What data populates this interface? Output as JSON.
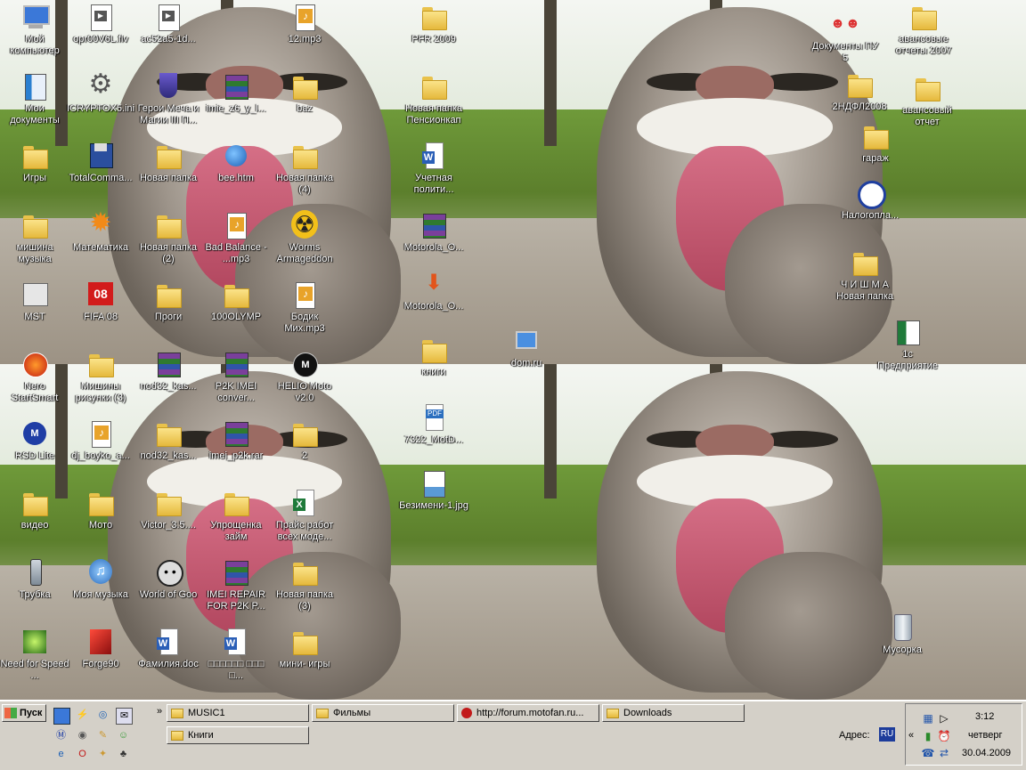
{
  "desktop": {
    "icons": [
      {
        "label": "Мой компьютер",
        "type": "computer"
      },
      {
        "label": "Мои документы",
        "type": "docs"
      },
      {
        "label": "Игры",
        "type": "folder"
      },
      {
        "label": "мишина музыка",
        "type": "folder"
      },
      {
        "label": "MST",
        "type": "mst"
      },
      {
        "label": "Nero StartSmart",
        "type": "round-red"
      },
      {
        "label": "RSD Lite",
        "type": "round-blue"
      },
      {
        "label": "видео",
        "type": "folder"
      },
      {
        "label": "Трубка",
        "type": "phone"
      },
      {
        "label": "Need for Speed ...",
        "type": "nfs"
      },
      {
        "label": "opr00V6L.flv",
        "type": "video"
      },
      {
        "label": "ICRYPTOX5.ini",
        "type": "gear"
      },
      {
        "label": "TotalComma...",
        "type": "floppy"
      },
      {
        "label": "Математика",
        "type": "star"
      },
      {
        "label": "FIFA 08",
        "type": "fifa"
      },
      {
        "label": "Мишины рисунки (3)",
        "type": "folder"
      },
      {
        "label": "dj_boyko_a...",
        "type": "media"
      },
      {
        "label": "Мото",
        "type": "folder"
      },
      {
        "label": "Моя музыка",
        "type": "music"
      },
      {
        "label": "Forge90",
        "type": "forge"
      },
      {
        "label": "ac52a5-1d...",
        "type": "video"
      },
      {
        "label": "Герои Меча и Магии III П...",
        "type": "shield"
      },
      {
        "label": "Новая папка",
        "type": "folder"
      },
      {
        "label": "Новая папка (2)",
        "type": "folder"
      },
      {
        "label": "Проги",
        "type": "folder"
      },
      {
        "label": "nod32_kas...",
        "type": "rar"
      },
      {
        "label": "nod32_kas...",
        "type": "folder"
      },
      {
        "label": "Victor_3.5....",
        "type": "folder"
      },
      {
        "label": "World of Goo",
        "type": "goo"
      },
      {
        "label": "Фамилия.doc",
        "type": "doc-word"
      },
      {
        "label": "imie_z6_y_l...",
        "type": "rar"
      },
      {
        "label": "bee.htm",
        "type": "globe"
      },
      {
        "label": "Bad Balance - ...mp3",
        "type": "media"
      },
      {
        "label": "100OLYMP",
        "type": "folder"
      },
      {
        "label": "P2K IMEI conver...",
        "type": "rar"
      },
      {
        "label": "imei_p2k.rar",
        "type": "rar"
      },
      {
        "label": "Упрощенка займ",
        "type": "folder"
      },
      {
        "label": "IMEI REPAIR FOR P2K P...",
        "type": "rar"
      },
      {
        "label": "□□□□□□ □□□ □...",
        "type": "doc-word"
      },
      {
        "label": "12.mp3",
        "type": "media"
      },
      {
        "label": "baz",
        "type": "folder"
      },
      {
        "label": "Новая папка (4)",
        "type": "folder"
      },
      {
        "label": "Worms Armageddon",
        "type": "radiation"
      },
      {
        "label": "Бодик Мих.mp3",
        "type": "media"
      },
      {
        "label": "HELIO Moto v2.0",
        "type": "round-black"
      },
      {
        "label": "2",
        "type": "folder"
      },
      {
        "label": "Прайс работ всех моде...",
        "type": "doc-excel"
      },
      {
        "label": "Новая папка (3)",
        "type": "folder"
      },
      {
        "label": "мини- игры",
        "type": "folder"
      },
      {
        "label": "PFR 2009",
        "type": "folder"
      },
      {
        "label": "Новая папка Пенсионкап",
        "type": "folder"
      },
      {
        "label": "Учетная полити...",
        "type": "doc-word"
      },
      {
        "label": "Motorola_O...",
        "type": "rar"
      },
      {
        "label": "Motorola_O...",
        "type": "install"
      },
      {
        "label": "книги",
        "type": "folder"
      },
      {
        "label": "7322_MotD...",
        "type": "doc-pdf"
      },
      {
        "label": "Безимени-1.jpg",
        "type": "image"
      },
      {
        "label": "dom.ru",
        "type": "netpc"
      },
      {
        "label": "Документы ПУ 5",
        "type": "people"
      },
      {
        "label": "2НДФЛ2008",
        "type": "folder"
      },
      {
        "label": "гараж",
        "type": "folder"
      },
      {
        "label": "Налогопла...",
        "type": "tax"
      },
      {
        "label": "Ч И Ш М А Новая папка",
        "type": "folder"
      },
      {
        "label": "авансовые отчеты 2007",
        "type": "folder"
      },
      {
        "label": "авансовый отчет",
        "type": "folder"
      },
      {
        "label": "1с Предприятие",
        "type": "onec"
      },
      {
        "label": "Мусорка",
        "type": "trash"
      }
    ]
  },
  "taskbar": {
    "start_label": "Пуск",
    "quicklaunch": [
      "desktop-icon",
      "winamp-icon",
      "ie-icon",
      "mail-icon",
      "motorola-icon",
      "media-icon",
      "edit-icon",
      "messenger-icon",
      "ie-icon",
      "opera-icon",
      "tool-icon",
      "game-icon"
    ],
    "chevron": "»",
    "buttons": [
      {
        "label": "MUSIC1",
        "icon": "folder"
      },
      {
        "label": "Фильмы",
        "icon": "folder"
      },
      {
        "label": "http://forum.motofan.ru...",
        "icon": "browser"
      },
      {
        "label": "Downloads",
        "icon": "folder"
      },
      {
        "label": "Книги",
        "icon": "folder"
      }
    ],
    "address_label": "Адрес:",
    "language": "RU"
  },
  "tray": {
    "chevron": "«",
    "time": "3:12",
    "day": "четверг",
    "date": "30.04.2009"
  }
}
